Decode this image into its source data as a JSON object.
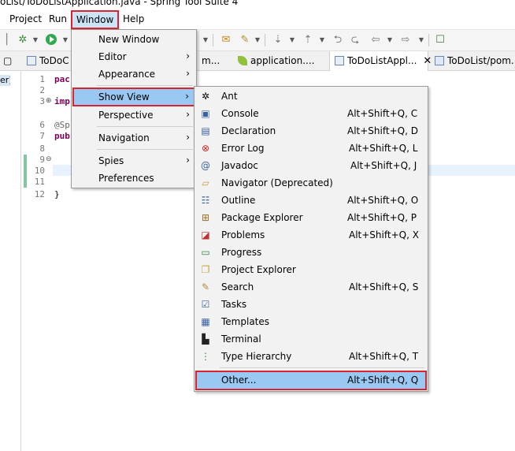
{
  "window_title": "oList/ToDoListApplication.java - Spring Tool Suite 4",
  "menubar": [
    {
      "label": "Project"
    },
    {
      "label": "Run"
    },
    {
      "label": "Window"
    },
    {
      "label": "Help"
    }
  ],
  "tabs": [
    {
      "label": "ToDoC"
    },
    {
      "label": "m..."
    },
    {
      "label": "application...."
    },
    {
      "label": "ToDoListAppl..."
    },
    {
      "label": "ToDoList/pom..."
    }
  ],
  "left_pane_label": "er]",
  "code": {
    "line_numbers": [
      "1",
      "2",
      "3",
      "6",
      "7",
      "8",
      "9",
      "10",
      "11",
      "12"
    ],
    "lines": [
      "pac",
      "imp",
      "@Sp",
      "pub",
      "}"
    ]
  },
  "colors": {
    "highlight": "#99c8f2",
    "red_box": "#d9242f",
    "menu_bg": "#f2f2f2"
  },
  "window_menu": {
    "items": [
      {
        "label": "New Window",
        "submenu": false
      },
      {
        "label": "Editor",
        "submenu": true
      },
      {
        "label": "Appearance",
        "submenu": true
      },
      {
        "label": "Show View",
        "submenu": true,
        "highlighted": true
      },
      {
        "label": "Perspective",
        "submenu": true
      },
      {
        "label": "Navigation",
        "submenu": true
      },
      {
        "label": "Spies",
        "submenu": true
      },
      {
        "label": "Preferences",
        "submenu": false
      }
    ]
  },
  "show_view_menu": {
    "items": [
      {
        "label": "Ant",
        "accel": "",
        "icon": "ant-icon"
      },
      {
        "label": "Console",
        "accel": "Alt+Shift+Q, C",
        "icon": "console-icon"
      },
      {
        "label": "Declaration",
        "accel": "Alt+Shift+Q, D",
        "icon": "declaration-icon"
      },
      {
        "label": "Error Log",
        "accel": "Alt+Shift+Q, L",
        "icon": "error-log-icon"
      },
      {
        "label": "Javadoc",
        "accel": "Alt+Shift+Q, J",
        "icon": "javadoc-icon"
      },
      {
        "label": "Navigator (Deprecated)",
        "accel": "",
        "icon": "navigator-icon"
      },
      {
        "label": "Outline",
        "accel": "Alt+Shift+Q, O",
        "icon": "outline-icon"
      },
      {
        "label": "Package Explorer",
        "accel": "Alt+Shift+Q, P",
        "icon": "package-explorer-icon"
      },
      {
        "label": "Problems",
        "accel": "Alt+Shift+Q, X",
        "icon": "problems-icon"
      },
      {
        "label": "Progress",
        "accel": "",
        "icon": "progress-icon"
      },
      {
        "label": "Project Explorer",
        "accel": "",
        "icon": "project-explorer-icon"
      },
      {
        "label": "Search",
        "accel": "Alt+Shift+Q, S",
        "icon": "search-icon"
      },
      {
        "label": "Tasks",
        "accel": "",
        "icon": "tasks-icon"
      },
      {
        "label": "Templates",
        "accel": "",
        "icon": "templates-icon"
      },
      {
        "label": "Terminal",
        "accel": "",
        "icon": "terminal-icon"
      },
      {
        "label": "Type Hierarchy",
        "accel": "Alt+Shift+Q, T",
        "icon": "type-hierarchy-icon"
      },
      {
        "label": "Other...",
        "accel": "Alt+Shift+Q, Q",
        "icon": "",
        "highlighted": true
      }
    ]
  }
}
